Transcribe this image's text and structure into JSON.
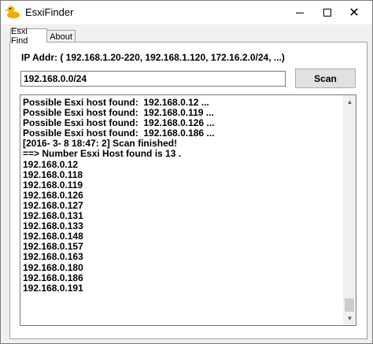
{
  "window": {
    "title": "EsxiFinder",
    "minimize_glyph": "",
    "close_glyph": "✕"
  },
  "tabs": [
    {
      "label": "Esxi Find",
      "active": true
    },
    {
      "label": "About",
      "active": false
    }
  ],
  "form": {
    "ip_label": "IP Addr: ( 192.168.1.20-220, 192.168.1.120, 172.16.2.0/24, ...)",
    "ip_value": "192.168.0.0/24",
    "scan_label": "Scan"
  },
  "log": {
    "lines": [
      "Possible Esxi host found:  192.168.0.12 ...",
      "Possible Esxi host found:  192.168.0.119 ...",
      "Possible Esxi host found:  192.168.0.126 ...",
      "Possible Esxi host found:  192.168.0.186 ...",
      "[2016- 3- 8 18:47: 2] Scan finished!",
      "==> Number Esxi Host found is 13 .",
      "192.168.0.12",
      "192.168.0.118",
      "192.168.0.119",
      "192.168.0.126",
      "192.168.0.127",
      "192.168.0.131",
      "192.168.0.133",
      "192.168.0.148",
      "192.168.0.157",
      "192.168.0.163",
      "192.168.0.180",
      "192.168.0.186",
      "192.168.0.191",
      "",
      "",
      ""
    ]
  },
  "colors": {
    "window_bg": "#f0f0f0",
    "icon_body": "#f2a900"
  }
}
